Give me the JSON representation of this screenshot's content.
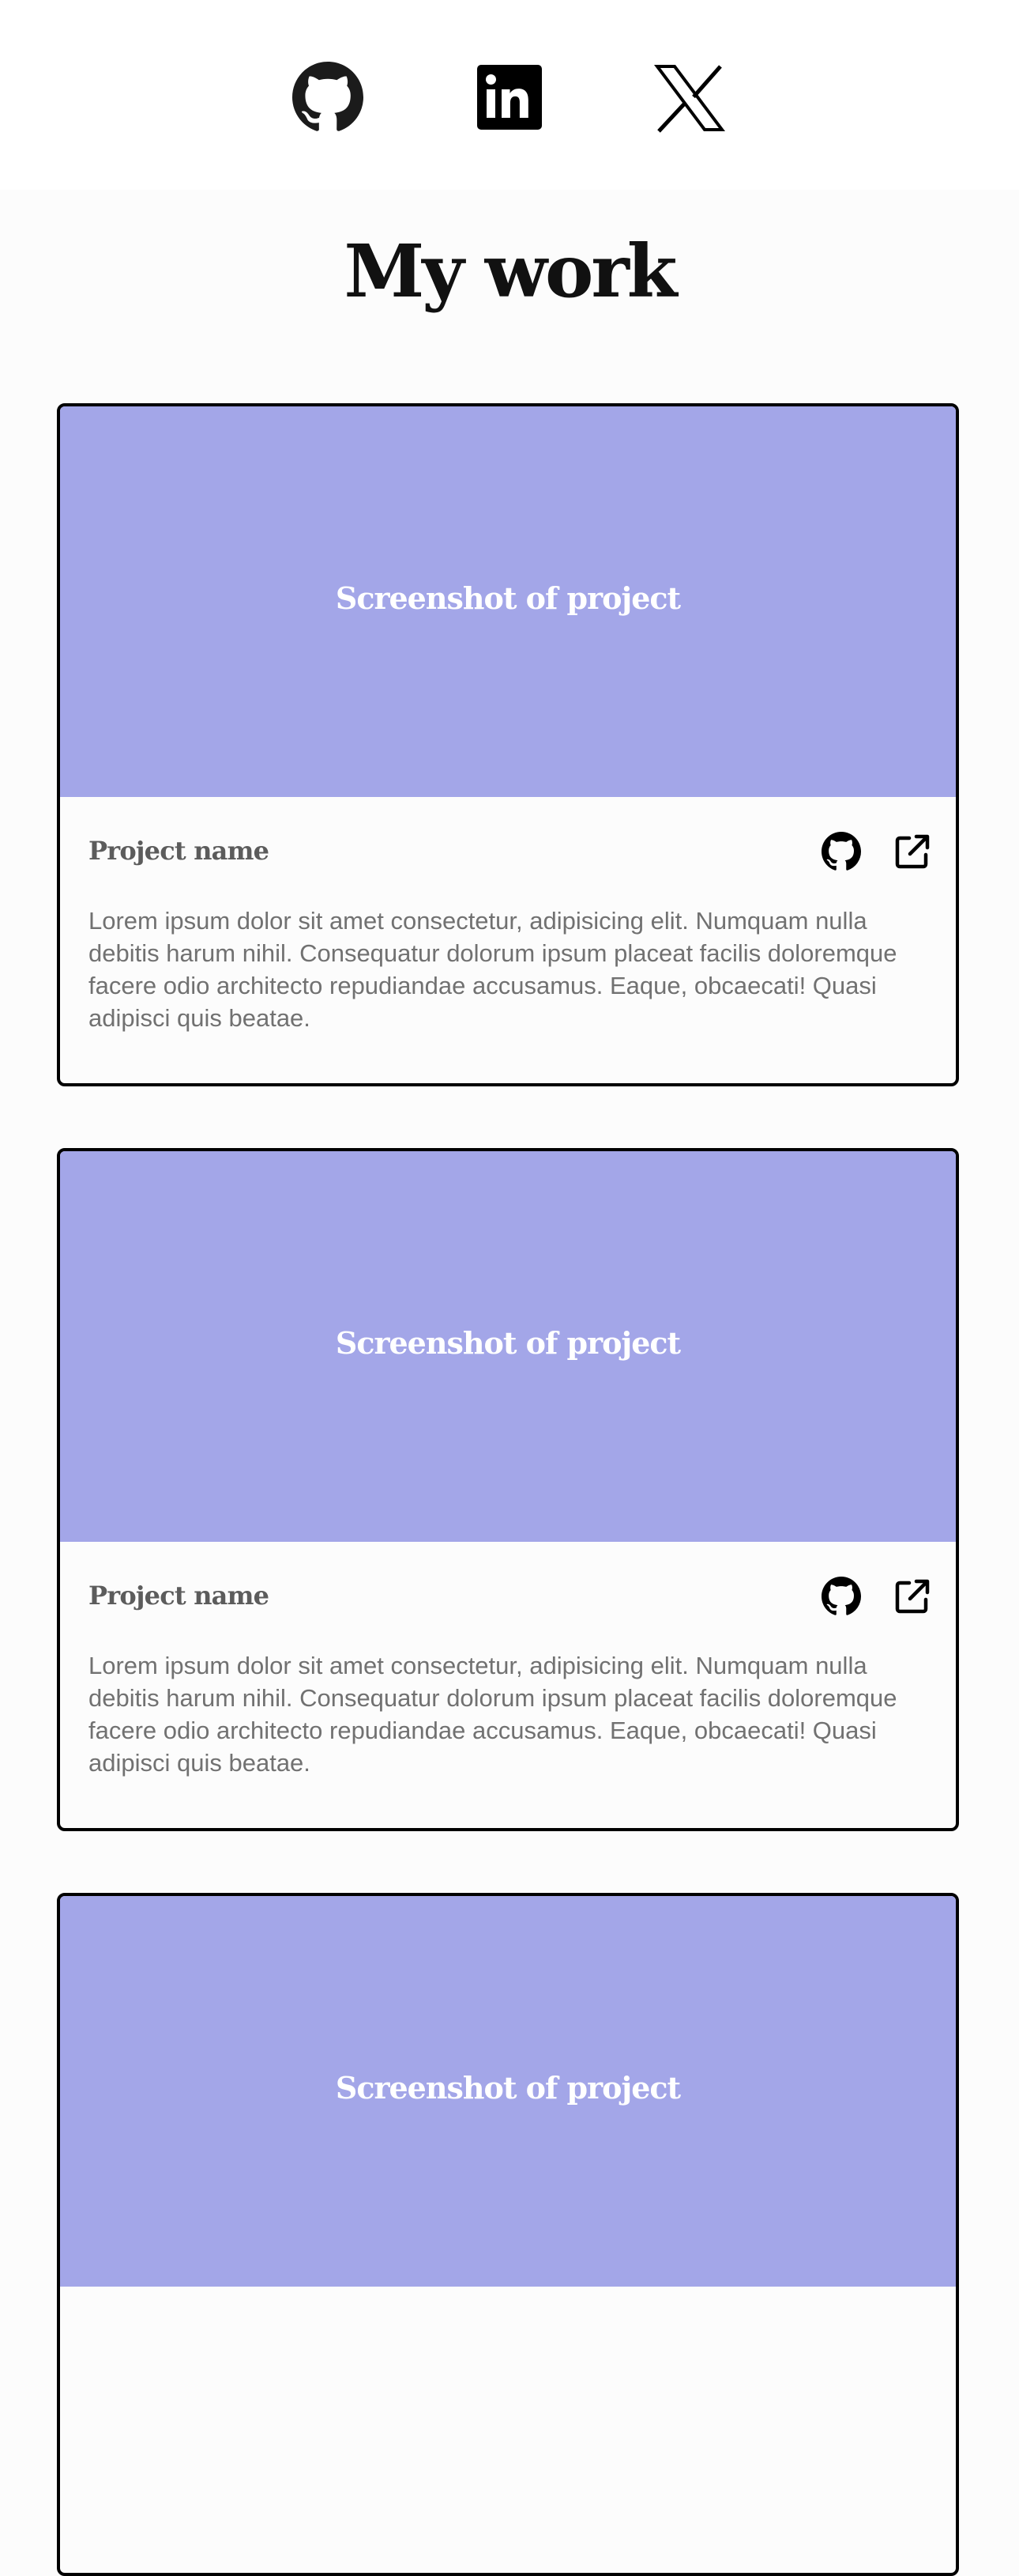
{
  "social": {
    "items": [
      {
        "name": "github-icon"
      },
      {
        "name": "linkedin-icon"
      },
      {
        "name": "x-icon"
      }
    ]
  },
  "section": {
    "title": "My work"
  },
  "projects": [
    {
      "screenshot_label": "Screenshot of project",
      "name": "Project name",
      "description": "Lorem ipsum dolor sit amet consectetur, adipisicing elit. Numquam nulla debitis harum nihil. Consequatur dolorum ipsum placeat facilis doloremque facere odio architecto repudiandae accusamus. Eaque, obcaecati! Quasi adipisci quis beatae.",
      "icons": [
        "github-icon",
        "external-link-icon"
      ]
    },
    {
      "screenshot_label": "Screenshot of project",
      "name": "Project name",
      "description": "Lorem ipsum dolor sit amet consectetur, adipisicing elit. Numquam nulla debitis harum nihil. Consequatur dolorum ipsum placeat facilis doloremque facere odio architecto repudiandae accusamus. Eaque, obcaecati! Quasi adipisci quis beatae.",
      "icons": [
        "github-icon",
        "external-link-icon"
      ]
    },
    {
      "screenshot_label": "Screenshot of project"
    }
  ],
  "colors": {
    "background": "#fcfcfc",
    "screenshot_placeholder": "#a3a6e8",
    "card_border": "#000000",
    "title": "#111111",
    "project_name": "#5c5c5c",
    "description": "#717171"
  }
}
